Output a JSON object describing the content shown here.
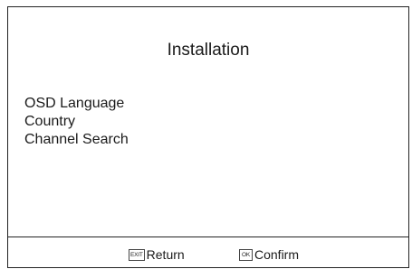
{
  "title": "Installation",
  "menu": {
    "items": [
      {
        "label": "OSD Language"
      },
      {
        "label": "Country"
      },
      {
        "label": "Channel Search"
      }
    ]
  },
  "footer": {
    "exit_key": "EXIT",
    "exit_label": "Return",
    "ok_key": "OK",
    "ok_label": "Confirm"
  }
}
